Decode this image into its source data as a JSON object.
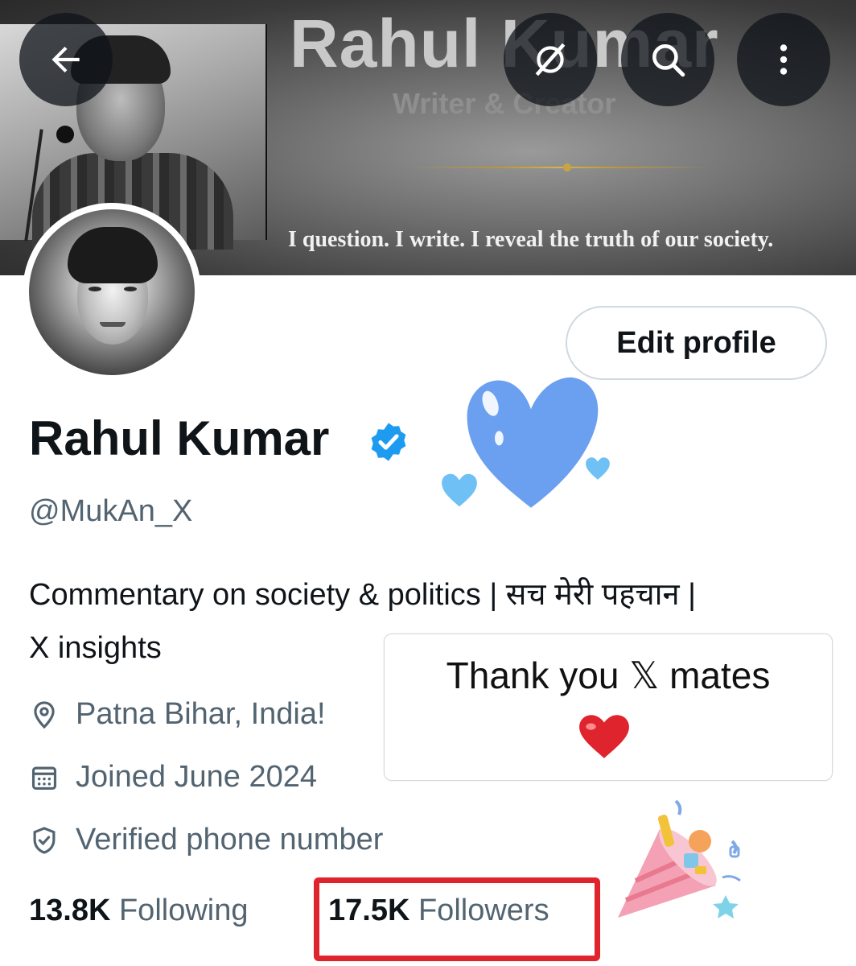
{
  "banner": {
    "title": "Rahul Kumar",
    "subtitle": "Writer & Creator",
    "tagline": "I question. I write. I reveal the truth of our society."
  },
  "topbar": {
    "back_icon": "arrow-left-icon",
    "grok_icon": "grok-icon",
    "search_icon": "search-icon",
    "more_icon": "more-vertical-icon"
  },
  "profile": {
    "edit_label": "Edit profile",
    "name": "Rahul Kumar",
    "handle": "@MukAn_X",
    "bio_line1": "Commentary on society & politics | सच मेरी पहचान |",
    "bio_line2": "X insights",
    "location": "Patna Bihar, India!",
    "joined": "Joined June 2024",
    "verified_phone": "Verified phone number"
  },
  "stats": {
    "following_count": "13.8K",
    "following_label": "Following",
    "followers_count": "17.5K",
    "followers_label": "Followers"
  },
  "overlay": {
    "thanks_text": "Thank you 𝕏 mates"
  },
  "colors": {
    "accent": "#1d9bf0",
    "secondary_text": "#536471",
    "highlight_border": "#e0242e",
    "sticker_heart": "#6b9ff0"
  }
}
